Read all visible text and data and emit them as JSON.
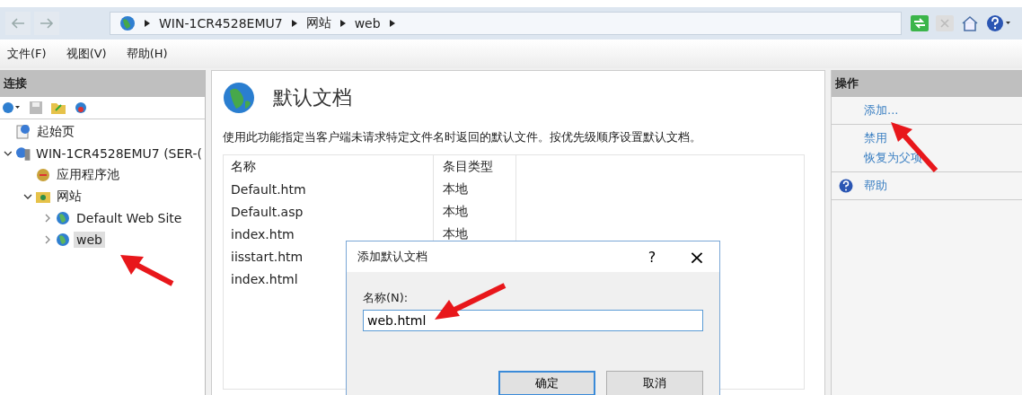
{
  "address_bar": {
    "crumbs": [
      "WIN-1CR4528EMU7",
      "网站",
      "web"
    ]
  },
  "menu": [
    "文件(F)",
    "视图(V)",
    "帮助(H)"
  ],
  "connections": {
    "title": "连接",
    "tree": [
      {
        "label": "起始页",
        "kind": "start",
        "selected": false
      },
      {
        "label": "WIN-1CR4528EMU7 (SER-(",
        "kind": "server",
        "expanded": true,
        "selected": false,
        "children": [
          {
            "label": "应用程序池",
            "kind": "pool",
            "selected": false
          },
          {
            "label": "网站",
            "kind": "sites",
            "expanded": true,
            "selected": false,
            "children": [
              {
                "label": "Default Web Site",
                "kind": "site",
                "expanded": false,
                "selected": false
              },
              {
                "label": "web",
                "kind": "site",
                "expanded": false,
                "selected": true
              }
            ]
          }
        ]
      }
    ]
  },
  "feature": {
    "title": "默认文档",
    "description": "使用此功能指定当客户端未请求特定文件名时返回的默认文件。按优先级顺序设置默认文档。",
    "columns": [
      "名称",
      "条目类型"
    ],
    "rows": [
      {
        "name": "Default.htm",
        "type": "本地"
      },
      {
        "name": "Default.asp",
        "type": "本地"
      },
      {
        "name": "index.htm",
        "type": "本地"
      },
      {
        "name": "iisstart.htm"
      },
      {
        "name": "index.html"
      }
    ]
  },
  "actions": {
    "title": "操作",
    "groups": [
      [
        {
          "label": "添加...",
          "kind": "link"
        }
      ],
      [
        {
          "label": "禁用",
          "kind": "link"
        },
        {
          "label": "恢复为父项",
          "kind": "link"
        }
      ],
      [
        {
          "label": "帮助",
          "kind": "help"
        }
      ]
    ]
  },
  "dialog": {
    "title": "添加默认文档",
    "help": "?",
    "close": "×",
    "field_label": "名称(N):",
    "value": "web.html",
    "buttons": [
      "确定",
      "取消"
    ]
  }
}
